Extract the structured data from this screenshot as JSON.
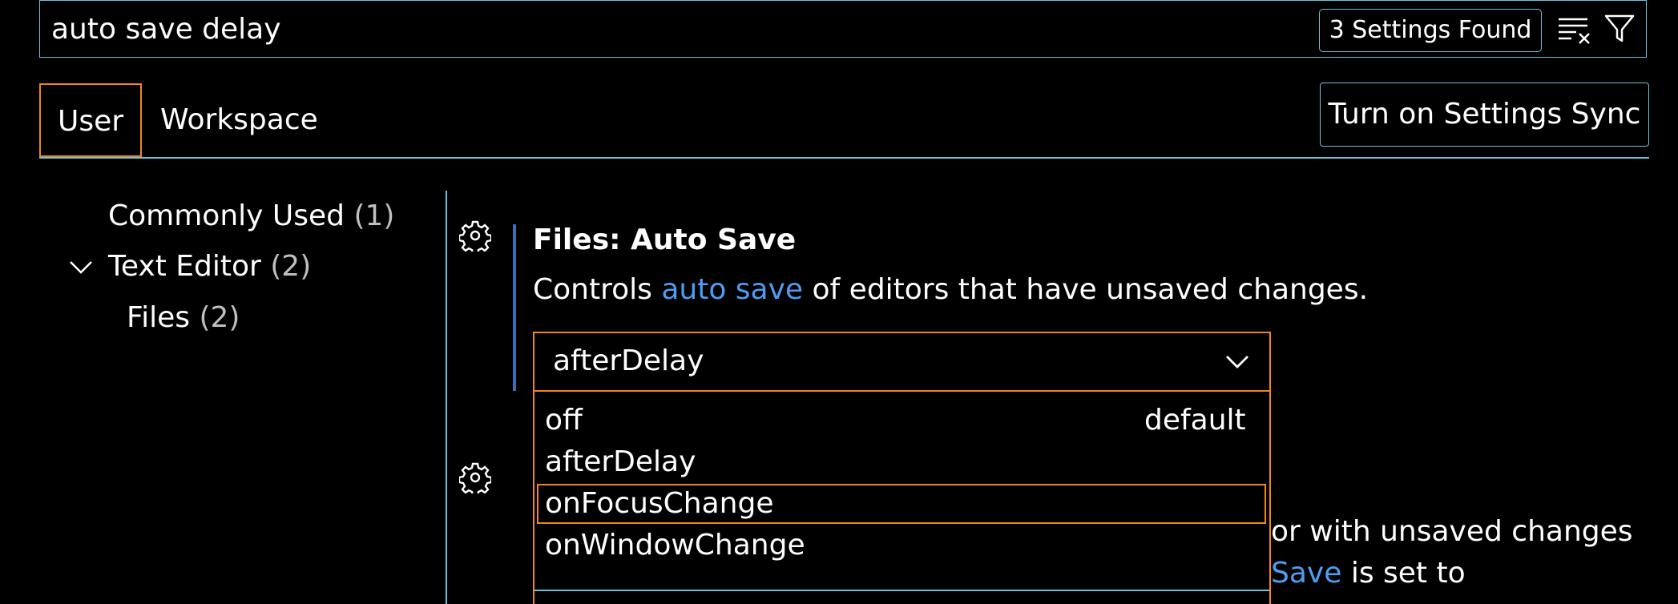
{
  "search": {
    "value": "auto save delay",
    "results_badge": "3 Settings Found"
  },
  "icons": {
    "clear": "clear-filter-icon",
    "filter": "filter-icon",
    "gear": "gear-icon",
    "chevron": "chevron-down-icon"
  },
  "tabs": [
    {
      "label": "User",
      "active": true
    },
    {
      "label": "Workspace",
      "active": false
    }
  ],
  "sync_button": "Turn on Settings Sync",
  "toc": [
    {
      "label": "Commonly Used",
      "count": "(1)"
    },
    {
      "label": "Text Editor",
      "count": "(2)",
      "expanded": true
    },
    {
      "label": "Files",
      "count": "(2)"
    }
  ],
  "setting": {
    "title": "Files: Auto Save",
    "desc_before": "Controls ",
    "desc_link": "auto save",
    "desc_after": " of editors that have unsaved changes.",
    "selected": "afterDelay",
    "options": [
      {
        "label": "off",
        "note": "default"
      },
      {
        "label": "afterDelay"
      },
      {
        "label": "onFocusChange",
        "highlighted": true
      },
      {
        "label": "onWindowChange"
      }
    ]
  },
  "setting2": {
    "line1": "or with unsaved changes",
    "line2_link": "Save",
    "line2_after": " is set to"
  },
  "colors": {
    "accent_border": "#f38518",
    "focus_border": "#6fc3df",
    "link": "#4f9cf3",
    "modified_bar": "#3a6fb7"
  }
}
